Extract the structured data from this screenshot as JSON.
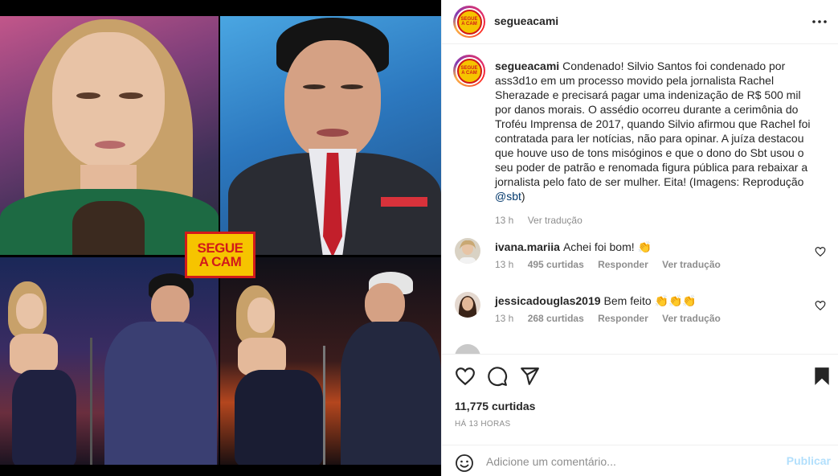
{
  "post": {
    "username": "segueacami",
    "logo_text_line1": "SEGUE",
    "logo_text_line2": "A CAM"
  },
  "caption": {
    "username": "segueacami",
    "text": "Condenado! Silvio Santos foi condenado por ass3d1o em um processo movido pela jornalista Rachel Sherazade e precisará pagar uma indenização de R$ 500 mil por danos morais. O assédio ocorreu durante a cerimônia do Troféu Imprensa de 2017, quando Silvio afirmou que Rachel foi contratada para ler notícias, não para opinar. A juíza destacou que houve uso de tons misóginos e que o dono do Sbt usou o seu poder de patrão e renomada figura pública para rebaixar a jornalista pelo fato de ser mulher. Eita! (Imagens: Reprodução ",
    "mention": "@sbt",
    "closing": ")",
    "time": "13 h",
    "see_translation": "Ver tradução"
  },
  "comments": [
    {
      "username": "ivana.mariia",
      "text": "Achei foi bom! 👏",
      "time": "13 h",
      "likes": "495 curtidas",
      "reply": "Responder",
      "see_translation": "Ver tradução"
    },
    {
      "username": "jessicadouglas2019",
      "text": "Bem feito 👏👏👏",
      "time": "13 h",
      "likes": "268 curtidas",
      "reply": "Responder",
      "see_translation": "Ver tradução"
    }
  ],
  "actions": {
    "likes_count": "11,775 curtidas",
    "posted_ago": "HÁ 13 HORAS"
  },
  "add_comment": {
    "placeholder": "Adicione um comentário...",
    "post_label": "Publicar"
  },
  "colors": {
    "link": "#00376b",
    "muted": "#8e8e8e",
    "post_disabled": "#b2dffc",
    "logo_yellow": "#f6c400",
    "logo_red": "#d21a1a"
  }
}
